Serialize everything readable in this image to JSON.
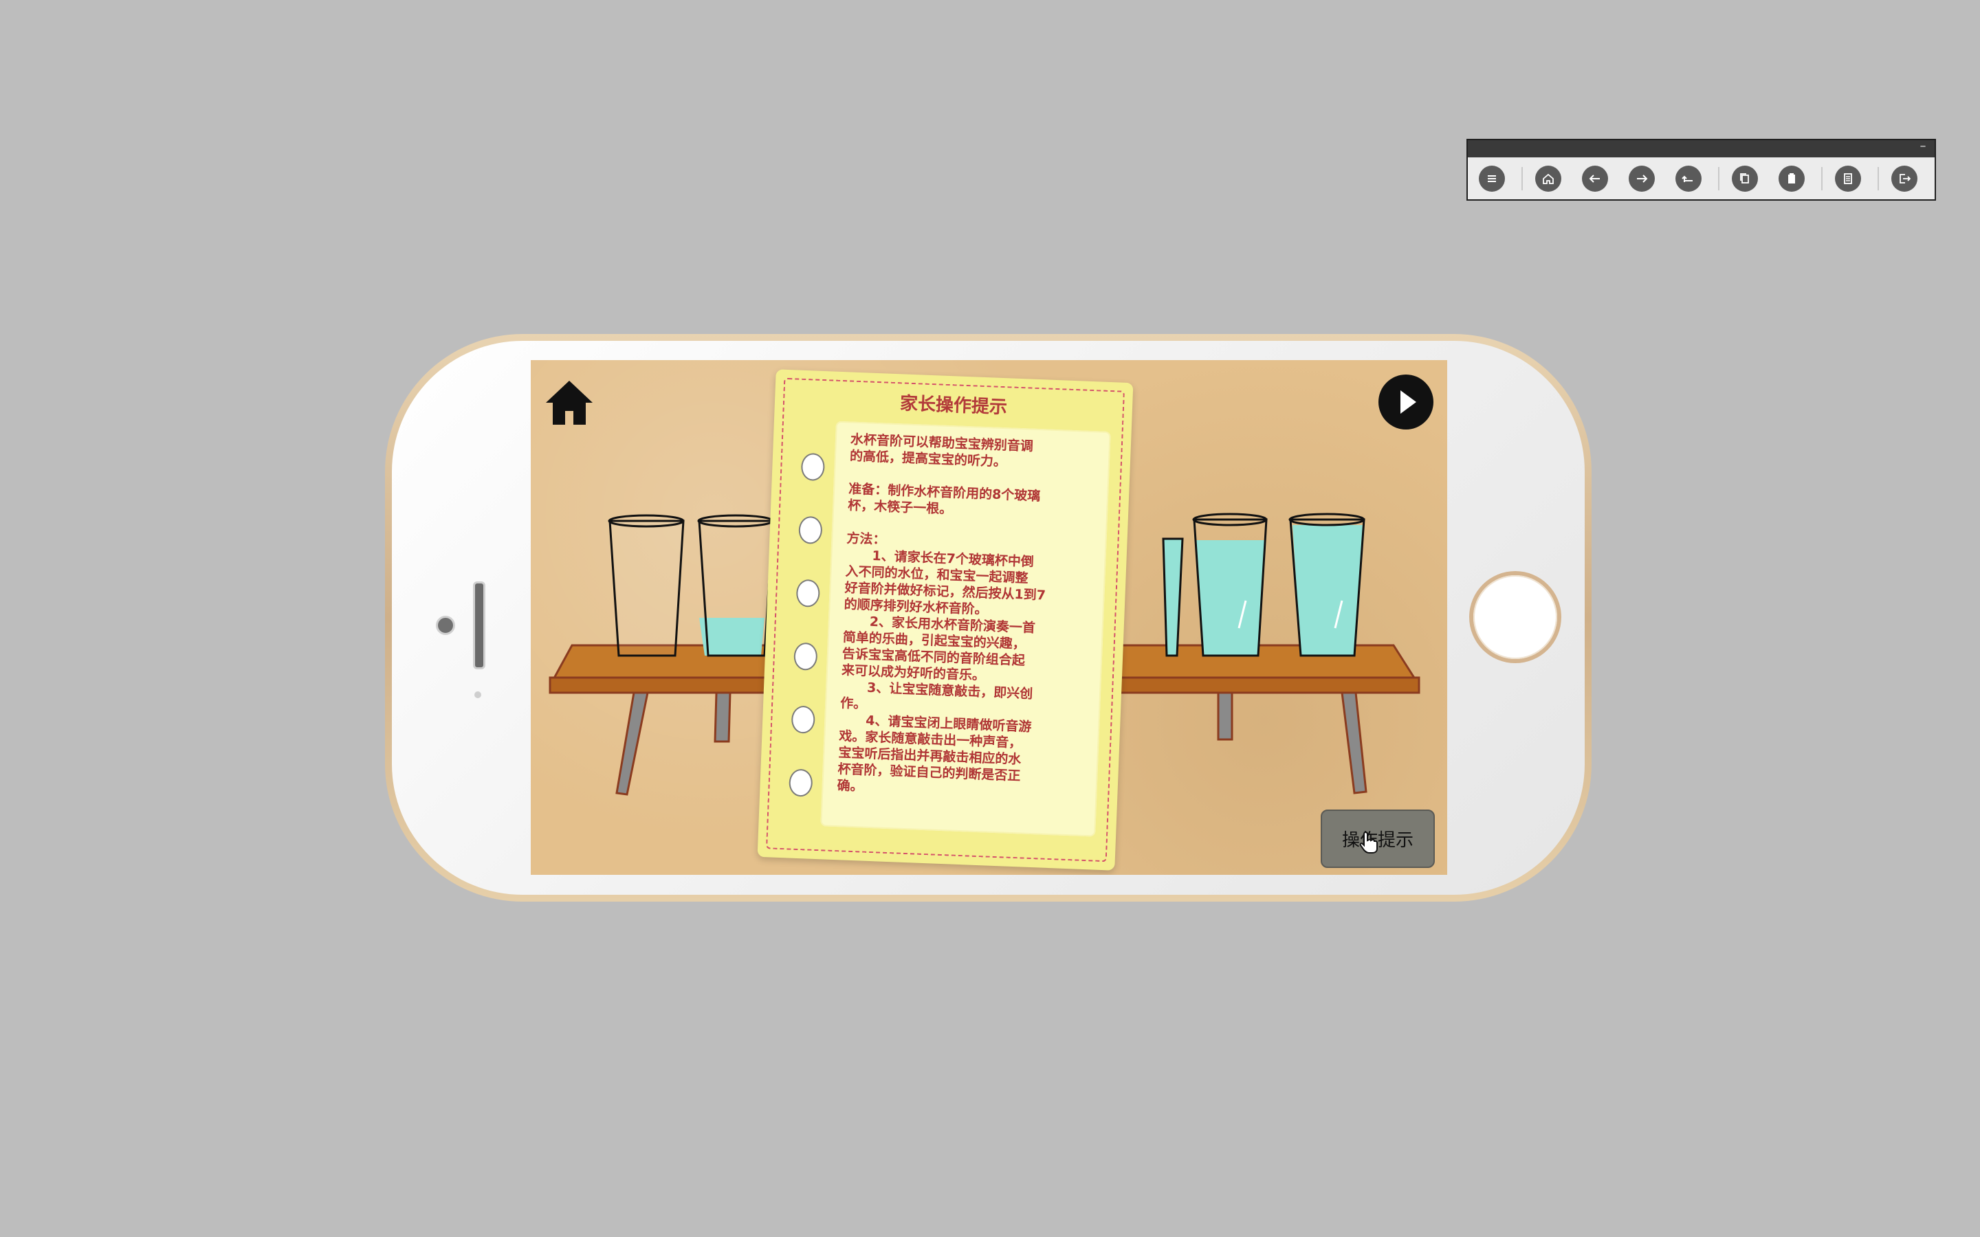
{
  "toolbar": {
    "minimize_label": "–",
    "buttons": [
      {
        "icon": "menu-icon"
      },
      {
        "icon": "home-icon"
      },
      {
        "icon": "arrow-left-icon"
      },
      {
        "icon": "arrow-right-icon"
      },
      {
        "icon": "return-icon"
      },
      {
        "icon": "copy-icon"
      },
      {
        "icon": "paste-icon"
      },
      {
        "icon": "document-icon"
      },
      {
        "icon": "exit-icon"
      }
    ]
  },
  "screen": {
    "tip_card": {
      "title": "家长操作提示",
      "body": "水杯音阶可以帮助宝宝辨别音调\n的高低，提高宝宝的听力。\n\n准备：制作水杯音阶用的8个玻璃\n杯，木筷子一根。\n\n方法：\n　　1、请家长在7个玻璃杯中倒\n入不同的水位，和宝宝一起调整\n好音阶并做好标记，然后按从1到7\n的顺序排列好水杯音阶。\n　　2、家长用水杯音阶演奏一首\n简单的乐曲，引起宝宝的兴趣，\n告诉宝宝高低不同的音阶组合起\n来可以成为好听的音乐。\n　　3、让宝宝随意敲击，即兴创\n作。\n　　4、请宝宝闭上眼睛做听音游\n戏。家长随意敲击出一种声音，\n宝宝听后指出并再敲击相应的水\n杯音阶，验证自己的判断是否正\n确。"
    },
    "tip_button_label": "操作提示"
  },
  "colors": {
    "background": "#bdbdbd",
    "screen_bg": "#e4c08c",
    "card": "#f4ef8e",
    "card_text": "#b03535",
    "water": "#94e2d6",
    "table": "#c77a2a"
  }
}
